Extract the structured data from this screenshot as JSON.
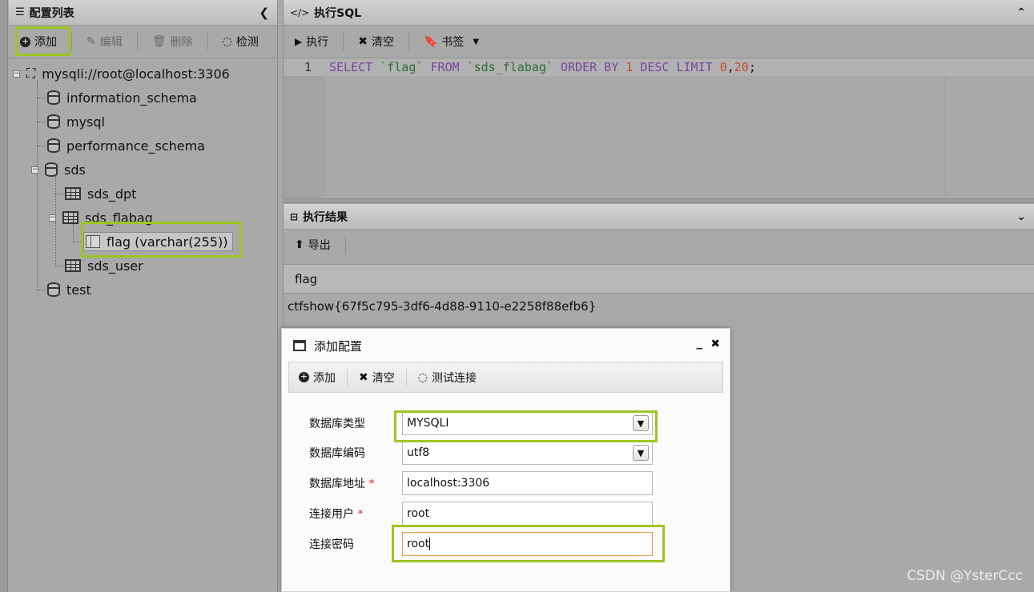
{
  "left_panel": {
    "title": "配置列表",
    "collapse_icon": "chevron-left-icon",
    "toolbar": {
      "add": "添加",
      "edit": "编辑",
      "delete": "删除",
      "check": "检测"
    },
    "tree": {
      "root": "mysqli://root@localhost:3306",
      "databases": [
        "information_schema",
        "mysql",
        "performance_schema",
        "sds",
        "test"
      ],
      "tables": [
        "sds_dpt",
        "sds_flabag",
        "sds_user"
      ],
      "column": "flag (varchar(255))"
    }
  },
  "sql_panel": {
    "title": "执行SQL",
    "toolbar": {
      "execute": "执行",
      "clear": "清空",
      "bookmark": "书签"
    },
    "editor": {
      "line_number": "1",
      "tokens": [
        "SELECT",
        "`flag`",
        "FROM",
        "`sds_flabag`",
        "ORDER BY",
        "1",
        "DESC",
        "LIMIT",
        "0",
        ",",
        "20",
        ";"
      ]
    }
  },
  "result_panel": {
    "title": "执行结果",
    "export": "导出",
    "column_header": "flag",
    "rows": [
      "ctfshow{67f5c795-3df6-4d88-9110-e2258f88efb6}"
    ]
  },
  "dialog": {
    "title": "添加配置",
    "minimize": "_",
    "close": "✖",
    "toolbar": {
      "add": "添加",
      "clear": "清空",
      "test": "测试连接"
    },
    "fields": {
      "db_type_label": "数据库类型",
      "db_type_value": "MYSQLI",
      "encoding_label": "数据库编码",
      "encoding_value": "utf8",
      "address_label": "数据库地址",
      "address_value": "localhost:3306",
      "user_label": "连接用户",
      "user_value": "root",
      "password_label": "连接密码",
      "password_value": "root",
      "required_mark": "*"
    }
  },
  "watermark": "CSDN @YsterCcc",
  "colors": {
    "highlight": "#9dc523",
    "keyword": "#77459c",
    "number": "#c44a2b"
  }
}
